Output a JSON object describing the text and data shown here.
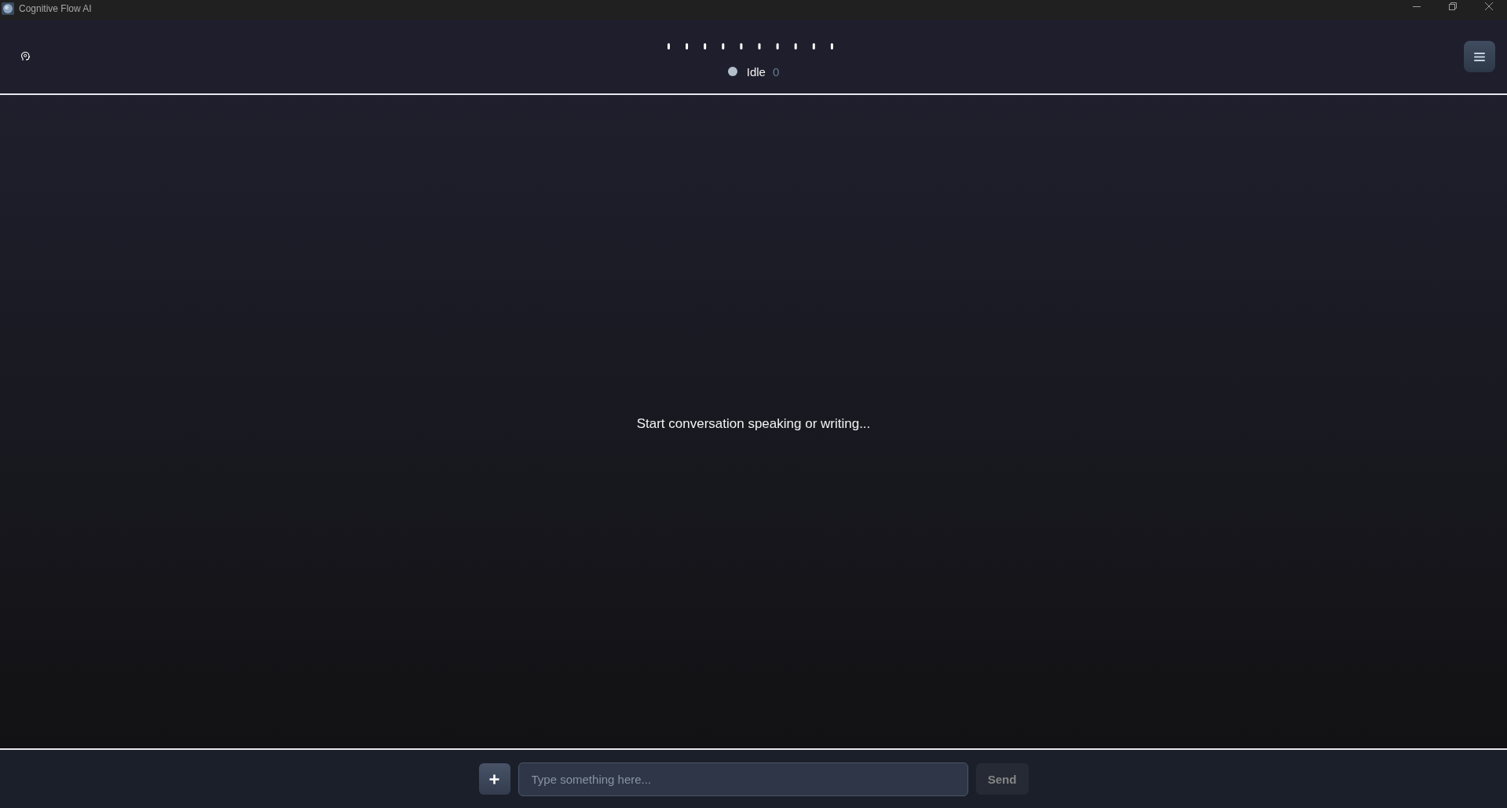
{
  "window": {
    "title": "Cognitive Flow AI"
  },
  "header": {
    "status": {
      "label": "Idle",
      "count": "0"
    }
  },
  "conversation": {
    "empty_message": "Start conversation speaking or writing..."
  },
  "composer": {
    "input": {
      "placeholder": "Type something here..."
    },
    "send_button": {
      "label": "Send",
      "disabled": true
    }
  }
}
